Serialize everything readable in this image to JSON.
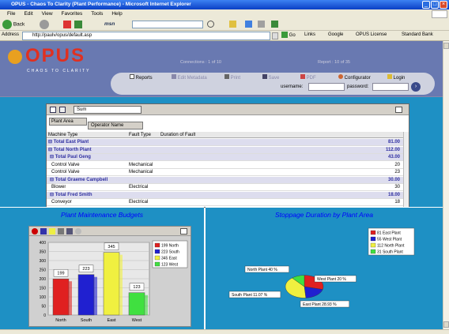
{
  "window": {
    "title": "OPUS - Chaos To Clarity (Plant Performance) - Microsoft Internet Explorer"
  },
  "menu": [
    "File",
    "Edit",
    "View",
    "Favorites",
    "Tools",
    "Help"
  ],
  "toolbar": {
    "back": "Back",
    "msn": "msn"
  },
  "address": {
    "label": "Address",
    "url": "http://paulv/opus/default.asp",
    "go": "Go",
    "links": "Links",
    "link1": "Google",
    "link2": "OPUS License",
    "link3": "Standard Bank"
  },
  "header": {
    "logo_text": "OPUS",
    "tagline": "CHAOS TO CLARITY",
    "connections": "Connections : 1 of 10",
    "report": "Report : 10 of 35",
    "nav": [
      "Reports",
      "Edit Metadata",
      "Print",
      "Save",
      "PDF",
      "Configurator",
      "Login"
    ],
    "username_label": "username:",
    "password_label": "password:"
  },
  "grid": {
    "agg_value": "Sum",
    "group_tabs": [
      "Plant Area",
      "Operator Name"
    ],
    "columns": [
      "Machine Type",
      "Fault Type",
      "Duration of Fault"
    ],
    "rows": [
      {
        "a": "Total East Plant",
        "b": "",
        "v": "81.00",
        "kind": "total"
      },
      {
        "a": "Total North Plant",
        "b": "",
        "v": "112.00",
        "kind": "total"
      },
      {
        "a": "Total Paul Geng",
        "b": "",
        "v": "43.00",
        "kind": "sub"
      },
      {
        "a": "Control Valve",
        "b": "Mechanical",
        "v": "20",
        "kind": "row"
      },
      {
        "a": "Control Valve",
        "b": "Mechanical",
        "v": "23",
        "kind": "row"
      },
      {
        "a": "Total Graeme Campbell",
        "b": "",
        "v": "30.00",
        "kind": "sub"
      },
      {
        "a": "Blower",
        "b": "Electrical",
        "v": "30",
        "kind": "row"
      },
      {
        "a": "Total Fred Smith",
        "b": "",
        "v": "18.00",
        "kind": "sub"
      },
      {
        "a": "Conveyor",
        "b": "Electrical",
        "v": "18",
        "kind": "row"
      }
    ]
  },
  "panels": {
    "left_title": "Plant Maintenance Budgets",
    "right_title": "Stoppage Duration by Plant Area"
  },
  "chart_data": [
    {
      "type": "bar",
      "categories": [
        "North",
        "South",
        "East",
        "West"
      ],
      "values": [
        199,
        223,
        345,
        123
      ],
      "ylim": [
        0,
        400
      ],
      "yticks": [
        0,
        50,
        100,
        150,
        200,
        250,
        300,
        350,
        400
      ],
      "legend": [
        "199 North",
        "223 South",
        "345 East",
        "123 West"
      ],
      "legend_position": "top-right",
      "colors": [
        "#e02020",
        "#2020d0",
        "#f0f040",
        "#40e040"
      ]
    },
    {
      "type": "pie",
      "categories": [
        "East Plant",
        "West Plant",
        "North Plant",
        "South Plant"
      ],
      "values": [
        81,
        55,
        112,
        31
      ],
      "data_labels": [
        "North Plant 40 %",
        "West Plant 20 %",
        "East Plant 28.93 %",
        "South Plant 11.07 %"
      ],
      "legend": [
        "81 East Plant",
        "55 West Plant",
        "112 North Plant",
        "31 South Plant"
      ],
      "legend_position": "top-right",
      "colors": [
        "#e02020",
        "#2020d0",
        "#f0f040",
        "#40e040"
      ]
    }
  ]
}
